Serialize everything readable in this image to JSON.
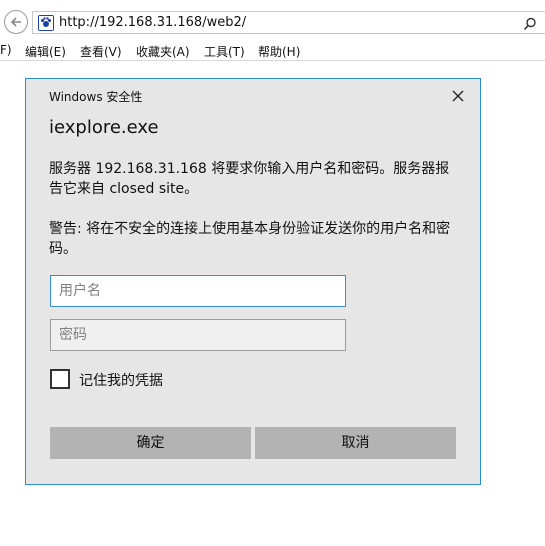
{
  "browser": {
    "url": "http://192.168.31.168/web2/",
    "menu": [
      "F)",
      "编辑(E)",
      "查看(V)",
      "收藏夹(A)",
      "工具(T)",
      "帮助(H)"
    ]
  },
  "dialog": {
    "caption": "Windows 安全性",
    "app": "iexplore.exe",
    "message1": "服务器 192.168.31.168 将要求你输入用户名和密码。服务器报告它来自 closed site。",
    "message2": "警告: 将在不安全的连接上使用基本身份验证发送你的用户名和密码。",
    "username_placeholder": "用户名",
    "password_placeholder": "密码",
    "remember_label": "记住我的凭据",
    "remember_checked": false,
    "ok_label": "确定",
    "cancel_label": "取消"
  },
  "colors": {
    "dialog_bg": "#e6e6e6",
    "dialog_border": "#2b8bd0",
    "focused_input_border": "#3c8ed1",
    "button_bg": "#b3b3b3"
  },
  "icons": {
    "back": "back-arrow-icon",
    "favicon": "site-favicon-icon",
    "search": "search-icon",
    "close": "close-icon"
  }
}
